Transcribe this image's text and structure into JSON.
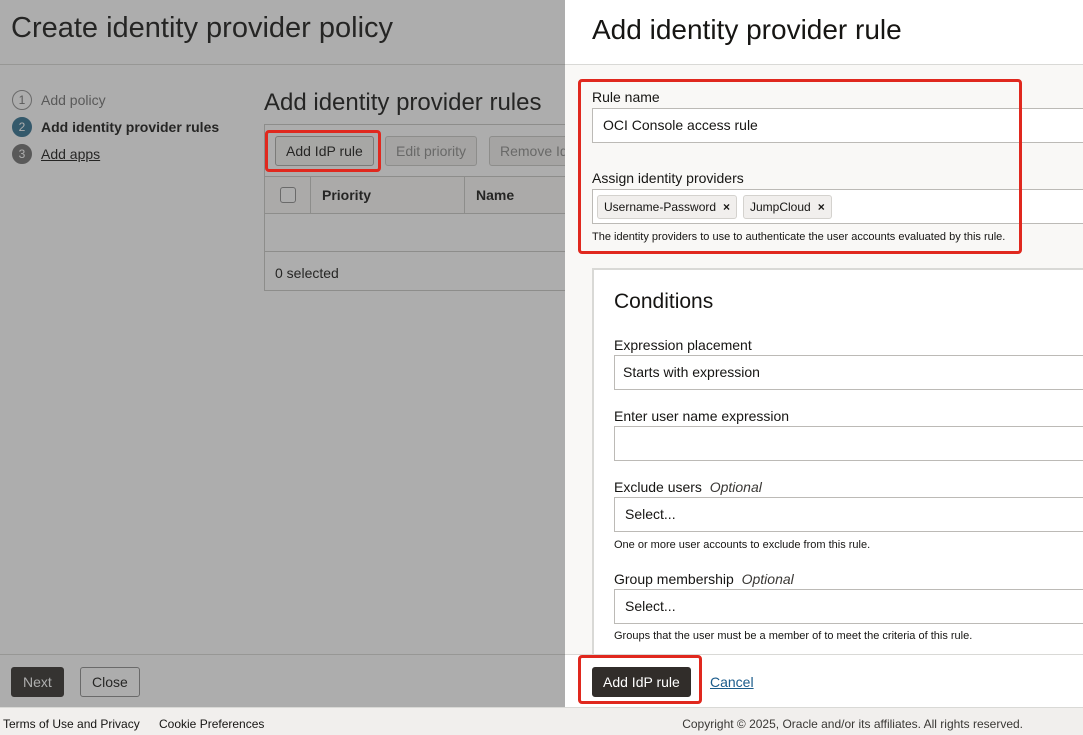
{
  "page": {
    "title": "Create identity provider policy",
    "steps": [
      {
        "num": "1",
        "label": "Add policy"
      },
      {
        "num": "2",
        "label": "Add identity provider rules"
      },
      {
        "num": "3",
        "label": "Add apps"
      }
    ],
    "section_title": "Add identity provider rules",
    "toolbar": {
      "add": "Add IdP rule",
      "edit_priority": "Edit priority",
      "remove": "Remove Id"
    },
    "table": {
      "columns": [
        "Priority",
        "Name"
      ],
      "selected_text": "0 selected"
    },
    "footer_buttons": {
      "next": "Next",
      "close": "Close"
    }
  },
  "panel": {
    "title": "Add identity provider rule",
    "rule_name": {
      "label": "Rule name",
      "value": "OCI Console access rule"
    },
    "assign_idps": {
      "label": "Assign identity providers",
      "chips": [
        "Username-Password",
        "JumpCloud"
      ],
      "remove_glyph": "×",
      "helper": "The identity providers to use to authenticate the user accounts evaluated by this rule."
    },
    "conditions": {
      "title": "Conditions",
      "expression_placement": {
        "label": "Expression placement",
        "value": "Starts with expression"
      },
      "user_name_expression": {
        "label": "Enter user name expression",
        "value": ""
      },
      "exclude_users": {
        "label": "Exclude users",
        "optional": "Optional",
        "placeholder": "Select...",
        "helper": "One or more user accounts to exclude from this rule."
      },
      "group_membership": {
        "label": "Group membership",
        "optional": "Optional",
        "placeholder": "Select...",
        "helper": "Groups that the user must be a member of to meet the criteria of this rule."
      }
    },
    "footer": {
      "primary": "Add IdP rule",
      "cancel": "Cancel"
    }
  },
  "site_footer": {
    "terms": "Terms of Use and Privacy",
    "cookies": "Cookie Preferences",
    "copyright": "Copyright © 2025, Oracle and/or its affiliates. All rights reserved."
  },
  "colors": {
    "highlight": "#e0281e",
    "primary_button": "#312d2a",
    "link": "#1a5b8b",
    "current_step": "#2f6e8e"
  }
}
